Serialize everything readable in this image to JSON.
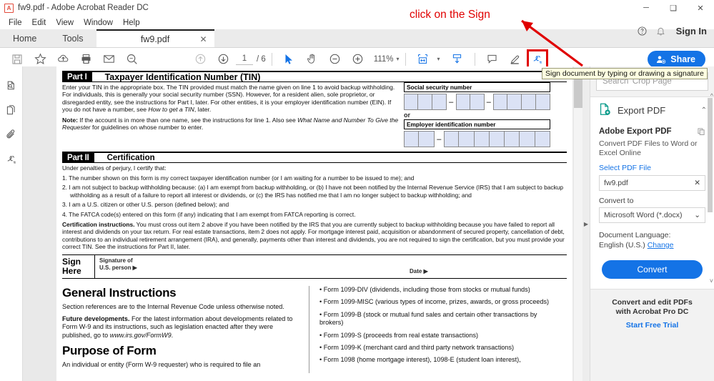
{
  "window": {
    "title": "fw9.pdf - Adobe Acrobat Reader DC",
    "app_icon": "pdf-file-icon",
    "minimize": "─",
    "maximize": "❑",
    "close": "✕"
  },
  "menubar": {
    "items": [
      "File",
      "Edit",
      "View",
      "Window",
      "Help"
    ]
  },
  "tabbar": {
    "home": "Home",
    "tools": "Tools",
    "document_tab": "fw9.pdf",
    "close_tab": "✕"
  },
  "toolbar": {
    "save_label": "save-icon",
    "page_current": "1",
    "page_total": "/ 6",
    "zoom_level": "111%",
    "zoom_caret": "▾",
    "share_label": "Share",
    "fit_caret": "▾"
  },
  "header_right": {
    "help": "?",
    "bell": "bell-icon",
    "sign_in": "Sign In"
  },
  "annotation": {
    "text": "click on the Sign",
    "color": "#e00000"
  },
  "tooltip": {
    "text": "Sign document by typing or drawing a signature"
  },
  "document": {
    "part1": {
      "label": "Part I",
      "title": "Taxpayer Identification Number (TIN)",
      "paragraph1": "Enter your TIN in the appropriate box. The TIN provided must match the name given on line 1 to avoid backup withholding. For individuals, this is generally your social security number (SSN). However, for a resident alien, sole proprietor, or disregarded entity, see the instructions for Part I, later. For other entities, it is your employer identification number (EIN). If you do not have a number, see ",
      "paragraph1_italic": "How to get a TIN",
      "paragraph1_end": ", later.",
      "note_label": "Note:",
      "note_text": " If the account is in more than one name, see the instructions for line 1. Also see ",
      "note_italic": "What Name and Number To Give the Requester",
      "note_end": " for guidelines on whose number to enter.",
      "ssn_label": "Social security number",
      "or_text": "or",
      "ein_label": "Employer identification number",
      "dash": "–"
    },
    "part2": {
      "label": "Part II",
      "title": "Certification",
      "intro": "Under penalties of perjury, I certify that:",
      "items": [
        "1. The number shown on this form is my correct taxpayer identification number (or I am waiting for a number to be issued to me); and",
        "2. I am not subject to backup withholding because: (a) I am exempt from backup withholding, or (b) I have not been notified by the Internal Revenue Service (IRS) that I am subject to backup withholding as a result of a failure to report all interest or dividends, or (c) the IRS has notified me that I am no longer subject to backup withholding; and",
        "3. I am a U.S. citizen or other U.S. person (defined below); and",
        "4. The FATCA code(s) entered on this form (if any) indicating that I am exempt from FATCA reporting is correct."
      ],
      "cert_label": "Certification instructions.",
      "cert_text": " You must cross out item 2 above if you have been notified by the IRS that you are currently subject to backup withholding because you have failed to report all interest and dividends on your tax return. For real estate transactions, item 2 does not apply. For mortgage interest paid, acquisition or abandonment of secured property, cancellation of debt, contributions to an individual retirement arrangement (IRA), and generally, payments other than interest and dividends, you are not required to sign the certification, but you must provide your correct TIN. See the instructions for Part II, later.",
      "sign_here": "Sign\nHere",
      "sign_here_line1": "Sign",
      "sign_here_line2": "Here",
      "signature_label_1": "Signature of",
      "signature_label_2": "U.S. person ▶",
      "date_label": "Date ▶"
    },
    "general": {
      "heading": "General Instructions",
      "p1": "Section references are to the Internal Revenue Code unless otherwise noted.",
      "future_label": "Future developments.",
      "future_text": " For the latest information about developments related to Form W-9 and its instructions, such as legislation enacted after they were published, go to ",
      "future_url": "www.irs.gov/FormW9",
      "future_end": ".",
      "purpose_heading": "Purpose of Form",
      "purpose_p": "An individual or entity (Form W-9 requester) who is required to file an"
    },
    "forms_list": [
      "• Form 1099-DIV (dividends, including those from stocks or mutual funds)",
      "• Form 1099-MISC (various types of income, prizes, awards, or gross proceeds)",
      "• Form 1099-B (stock or mutual fund sales and certain other transactions by brokers)",
      "• Form 1099-S (proceeds from real estate transactions)",
      "• Form 1099-K (merchant card and third party network transactions)",
      "• Form 1098 (home mortgage interest), 1098-E (student loan interest),"
    ]
  },
  "right_panel": {
    "search_placeholder": "Search 'Crop Page'",
    "export_pdf_title": "Export PDF",
    "collapse_caret": "⌃",
    "card_title": "Adobe Export PDF",
    "card_sub": "Convert PDF Files to Word or Excel Online",
    "select_pdf_link": "Select PDF File",
    "selected_file": "fw9.pdf",
    "clear_icon": "✕",
    "convert_to_label": "Convert to",
    "convert_to_value": "Microsoft Word (*.docx)",
    "select_caret": "⌄",
    "doc_lang_label": "Document Language:",
    "doc_lang_value": "English (U.S.)",
    "doc_lang_change": "Change",
    "convert_button": "Convert",
    "footer_line1": "Convert and edit PDFs",
    "footer_line2": "with Acrobat Pro DC",
    "footer_link": "Start Free Trial"
  },
  "left_rail": {
    "items": [
      "page-thumbnails-icon",
      "pages-icon",
      "attachment-icon",
      "sign-icon"
    ]
  },
  "colors": {
    "accent": "#1473e6",
    "annotation_red": "#e00000",
    "form_field": "#dbe2f5",
    "panel_bg": "#f2f2f2"
  }
}
